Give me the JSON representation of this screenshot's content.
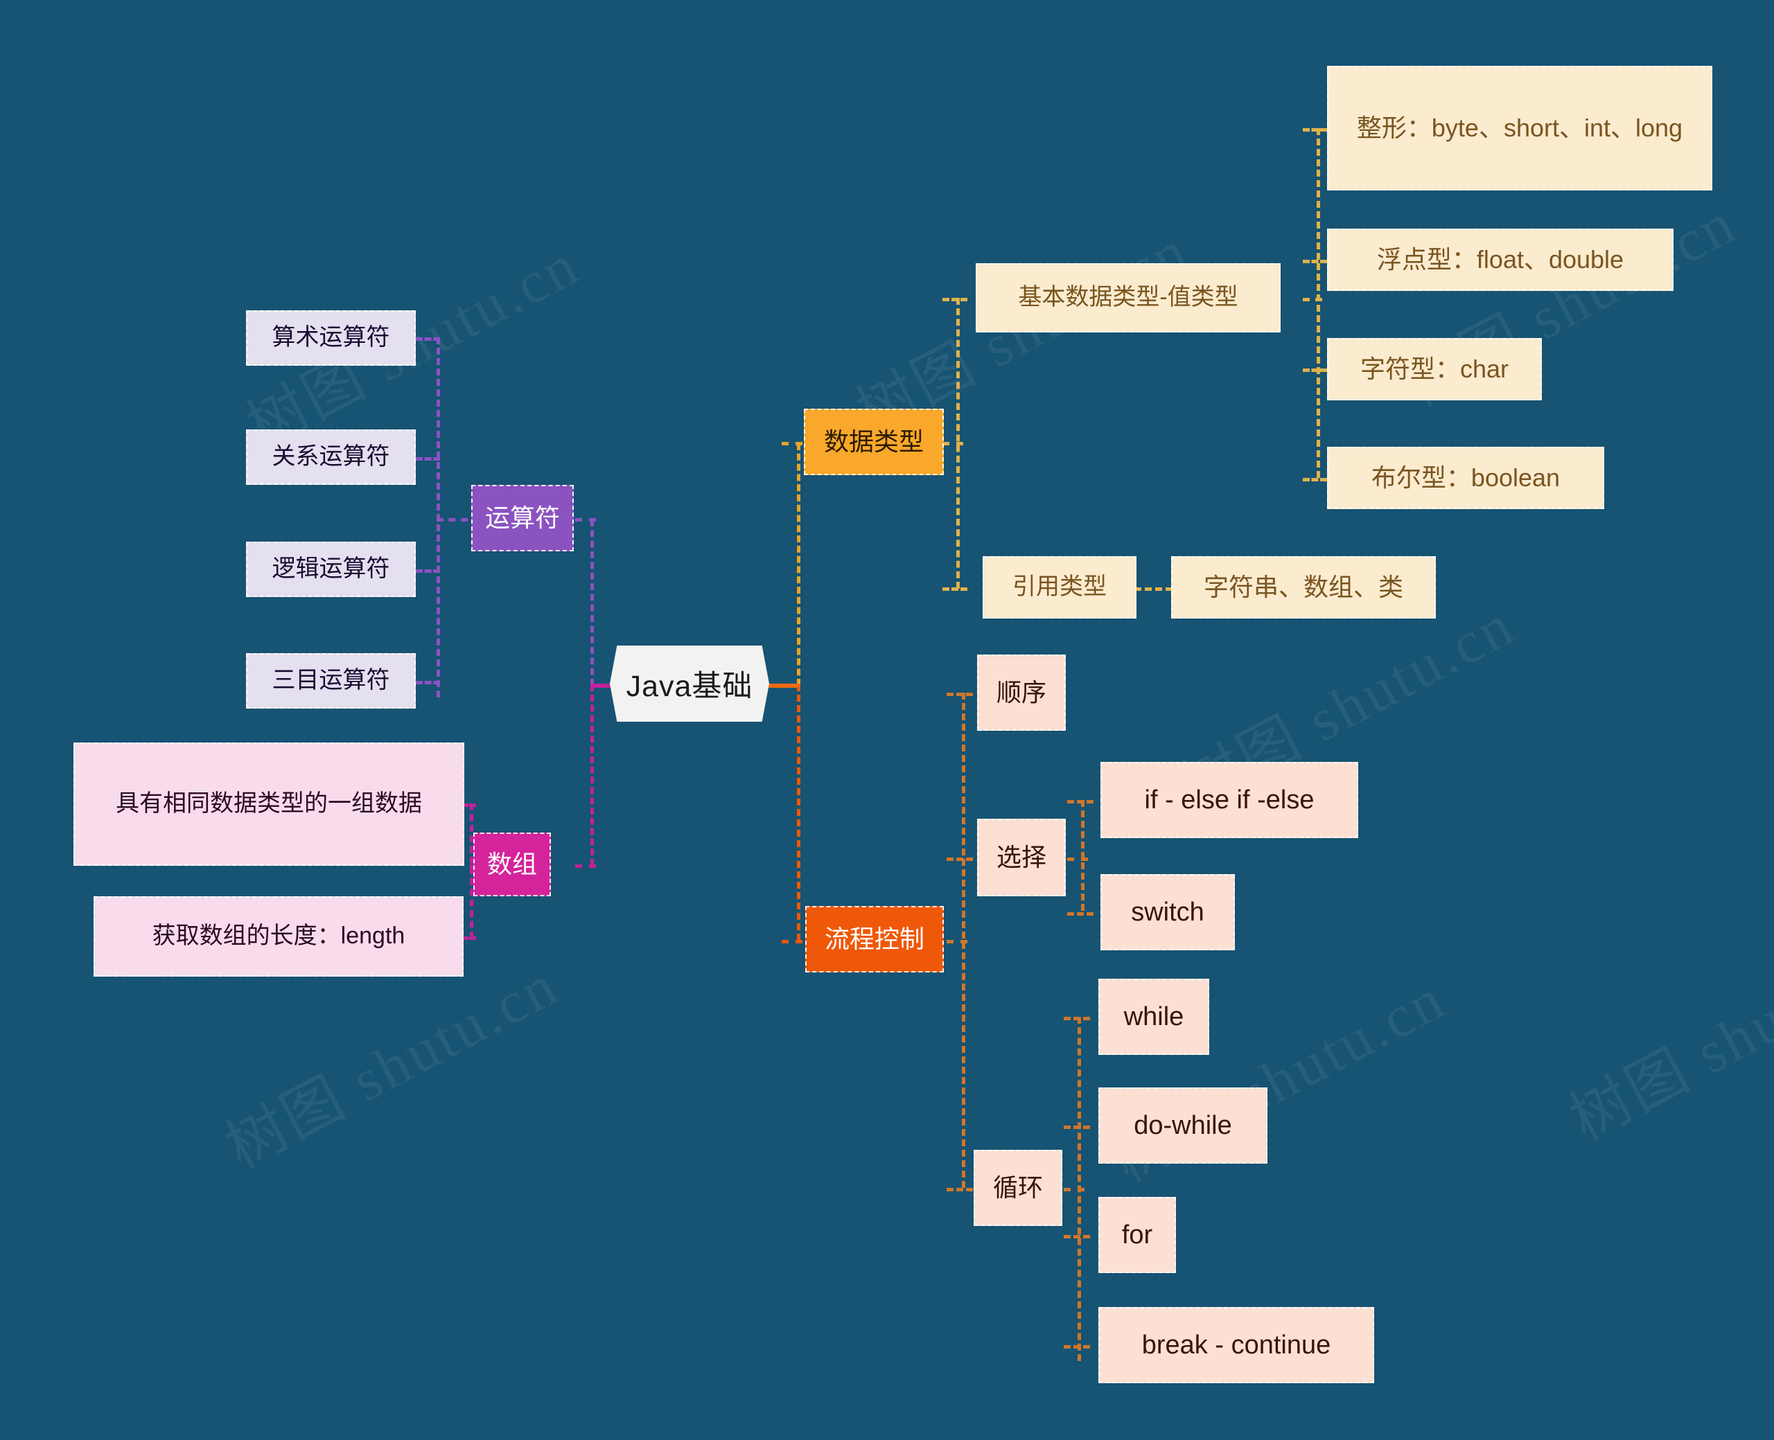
{
  "background_color": "#175372",
  "watermark_text": "树图 shutu.cn",
  "root": {
    "label": "Java基础",
    "color": "#F2F2F2"
  },
  "branches": {
    "operators": {
      "label": "运算符",
      "color": "#8A53C0",
      "children": [
        {
          "label": "算术运算符"
        },
        {
          "label": "关系运算符"
        },
        {
          "label": "逻辑运算符"
        },
        {
          "label": "三目运算符"
        }
      ]
    },
    "array": {
      "label": "数组",
      "color": "#D5239B",
      "children": [
        {
          "label": "具有相同数据类型的一组数据"
        },
        {
          "label": "获取数组的长度：length"
        }
      ]
    },
    "data_types": {
      "label": "数据类型",
      "color": "#F9A82B",
      "children": [
        {
          "label": "基本数据类型-值类型",
          "children": [
            {
              "label": "整形：byte、short、int、long"
            },
            {
              "label": "浮点型：float、double"
            },
            {
              "label": "字符型：char"
            },
            {
              "label": "布尔型：boolean"
            }
          ]
        },
        {
          "label": "引用类型",
          "children": [
            {
              "label": "字符串、数组、类"
            }
          ]
        }
      ]
    },
    "flow_control": {
      "label": "流程控制",
      "color": "#EF5808",
      "children": [
        {
          "label": "顺序",
          "children": []
        },
        {
          "label": "选择",
          "children": [
            {
              "label": "if - else if -else"
            },
            {
              "label": "switch"
            }
          ]
        },
        {
          "label": "循环",
          "children": [
            {
              "label": "while"
            },
            {
              "label": "do-while"
            },
            {
              "label": "for"
            },
            {
              "label": "break - continue"
            }
          ]
        }
      ]
    }
  }
}
